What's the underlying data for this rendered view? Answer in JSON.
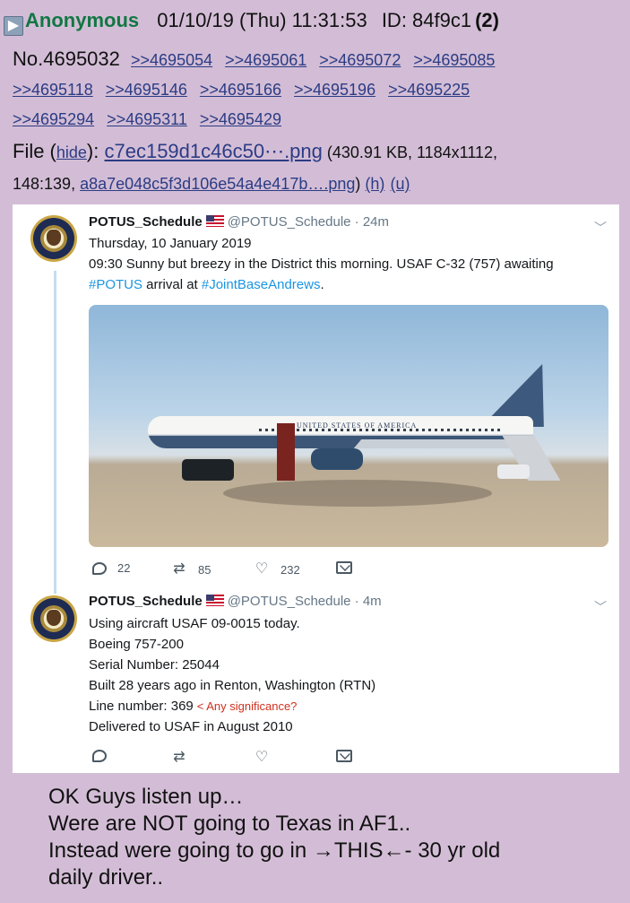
{
  "post": {
    "arrow": "▶",
    "name": "Anonymous",
    "datetime": "01/10/19 (Thu) 11:31:53",
    "id": "ID: 84f9c1",
    "count": "(2)",
    "number": "No.4695032",
    "replies": [
      ">>4695054",
      ">>4695061",
      ">>4695072",
      ">>4695085",
      ">>4695118",
      ">>4695146",
      ">>4695166",
      ">>4695196",
      ">>4695225",
      ">>4695294",
      ">>4695311",
      ">>4695429"
    ],
    "file": {
      "label": "File (",
      "hide": "hide",
      "after_hide": "): ",
      "filename": "c7ec159d1c46c50⋯.png",
      "meta1": " (430.91 KB, 1184x1112,",
      "meta2": "148:139, ",
      "orig_name": "a8a7e048c5f3d106e54a4e417b….png",
      "close": ") ",
      "h": "(h)",
      "u": "(u)"
    }
  },
  "tweets": [
    {
      "name": "POTUS_Schedule",
      "handle": "@POTUS_Schedule · 24m",
      "lines": [
        "Thursday, 10 January 2019",
        "09:30 Sunny but breezy in the District this morning. USAF C-32 (757) awaiting"
      ],
      "line3_tag1": "#POTUS",
      "line3_mid": " arrival at ",
      "line3_tag2": "#JointBaseAndrews",
      "line3_end": ".",
      "photo_text": "UNITED STATES OF AMERICA",
      "replies": "22",
      "retweets": "85",
      "likes": "232"
    },
    {
      "name": "POTUS_Schedule",
      "handle": "@POTUS_Schedule · 4m",
      "lines": [
        "Using aircraft USAF 09-0015 today.",
        "Boeing 757-200",
        "Serial Number: 25044",
        "Built 28 years ago in Renton, Washington (RTN)",
        "Line number: 369",
        "Delivered to USAF in August 2010"
      ],
      "note": "< Any significance?"
    }
  ],
  "comment": [
    "OK  Guys  listen up…",
    "Were are NOT going to Texas in  AF1..",
    "Instead were going to go in →THIS←- 30 yr old",
    "daily driver.."
  ],
  "icons": {
    "reply": "reply-icon",
    "retweet": "retweet-icon",
    "like": "heart-icon",
    "message": "mail-icon",
    "chevron": "chevron-down-icon"
  },
  "colors": {
    "background": "#d3bdd6",
    "name": "#117743",
    "link": "#2b3c84",
    "hashtag": "#1b95e0",
    "note": "#d0301e"
  }
}
